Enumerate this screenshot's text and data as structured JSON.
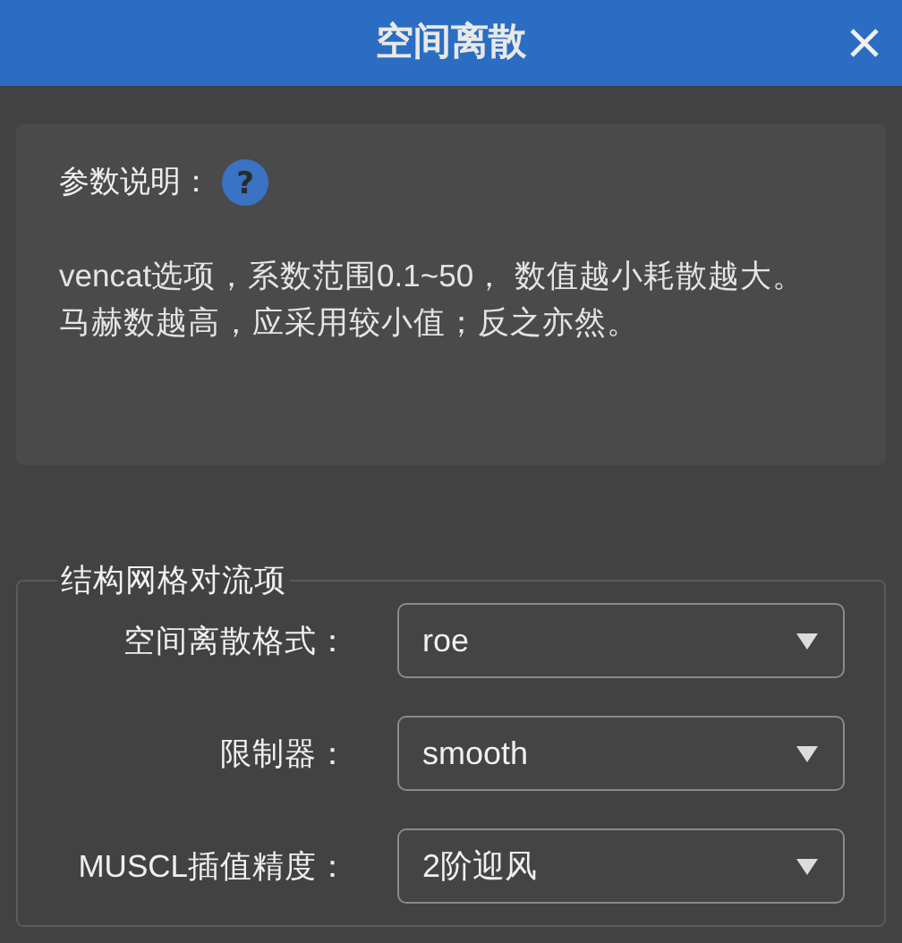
{
  "window": {
    "title": "空间离散"
  },
  "info": {
    "label": "参数说明：",
    "help_icon": "?",
    "description": "vencat选项，系数范围0.1~50， 数值越小耗散越大。马赫数越高，应采用较小值；反之亦然。"
  },
  "group": {
    "title": "结构网格对流项",
    "fields": [
      {
        "label": "空间离散格式：",
        "value": "roe"
      },
      {
        "label": "限制器：",
        "value": "smooth"
      },
      {
        "label": "MUSCL插值精度：",
        "value": "2阶迎风"
      }
    ]
  }
}
